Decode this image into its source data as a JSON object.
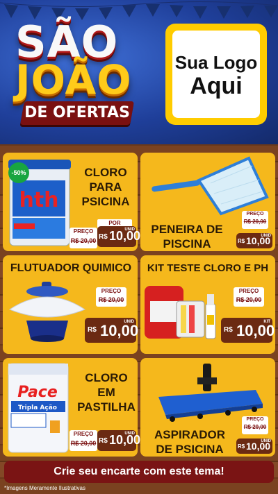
{
  "header": {
    "title_line1": "SÃO",
    "title_line2": "JOÃO",
    "title_line3": "DE OFERTAS",
    "logo_line1": "Sua Logo",
    "logo_line2": "Aqui"
  },
  "products": [
    {
      "name": "CLORO PARA PSICINA",
      "badge": "-50%",
      "old_label": "PREÇO",
      "old_price": "R$ 20,00",
      "por_label": "POR",
      "currency": "R$",
      "price": "10,00",
      "unit": "UNID",
      "brand": "hth"
    },
    {
      "name": "PENEIRA DE PISCINA",
      "old_label": "PREÇO",
      "old_price": "R$ 20,00",
      "por_label": "POR",
      "currency": "R$",
      "price": "10,00",
      "unit": "UNID"
    },
    {
      "name": "FLUTUADOR QUIMICO",
      "old_label": "PREÇO",
      "old_price": "R$ 20,00",
      "por_label": "POR",
      "currency": "R$",
      "price": "10,00",
      "unit": "UNID"
    },
    {
      "name": "KIT TESTE CLORO E PH",
      "old_label": "PREÇO",
      "old_price": "R$ 20,00",
      "por_label": "POR",
      "currency": "R$",
      "price": "10,00",
      "unit": "KIT"
    },
    {
      "name": "CLORO EM PASTILHA",
      "old_label": "PREÇO",
      "old_price": "R$ 20,00",
      "por_label": "POR",
      "currency": "R$",
      "price": "10,00",
      "unit": "UNID",
      "brand": "Pace",
      "sub": "Tripla Ação"
    },
    {
      "name": "ASPIRADOR DE PSICINA",
      "old_label": "PREÇO",
      "old_price": "R$ 20,00",
      "por_label": "POR",
      "currency": "R$",
      "price": "10,00",
      "unit": "UNID"
    }
  ],
  "cta": "Crie seu encarte com este tema!",
  "footnote": "*Imagens Meramente Ilustrativas",
  "colors": {
    "card": "#f5b81c",
    "price_box": "#6b2a12",
    "cta": "#7a1414",
    "header": "#1f3f9a",
    "title_yellow": "#ffcb1a"
  }
}
